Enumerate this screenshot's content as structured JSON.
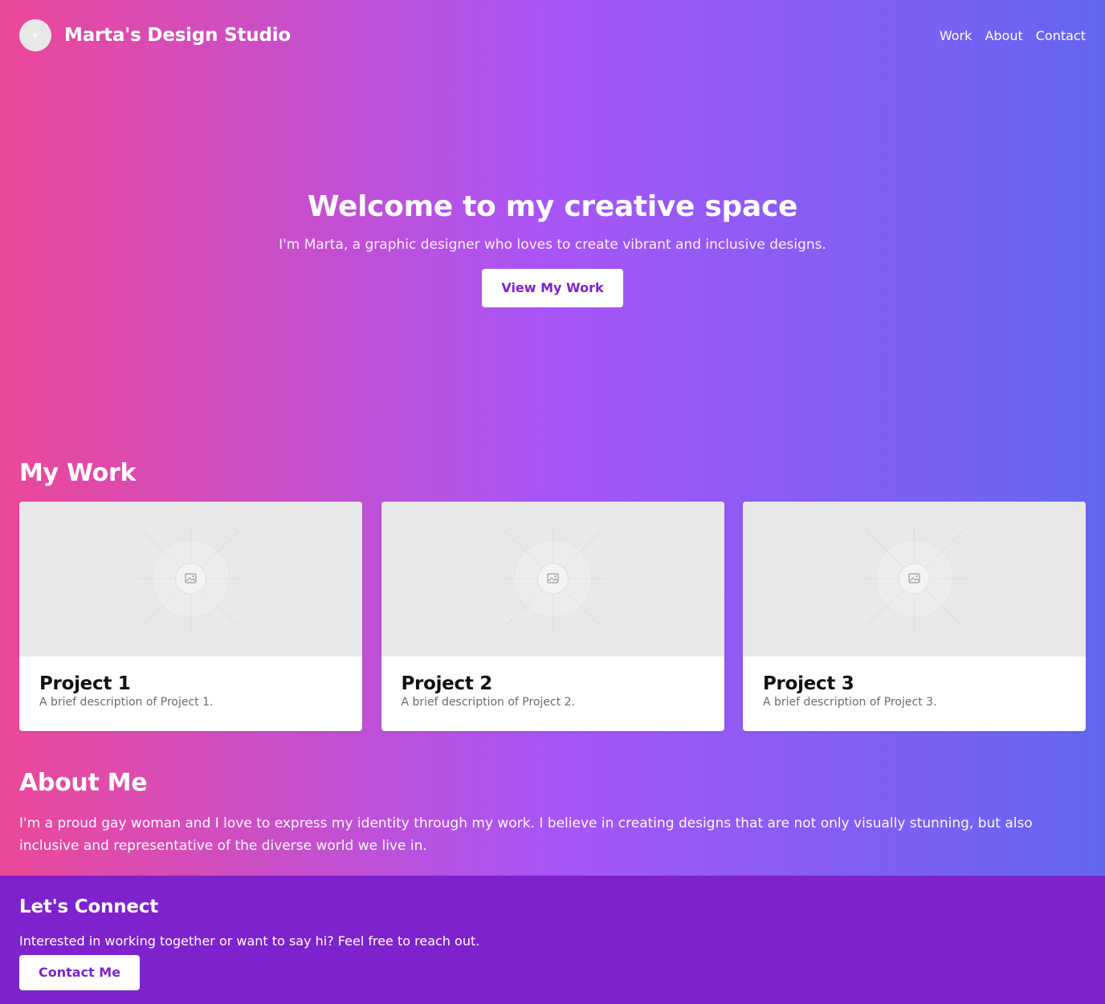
{
  "header": {
    "brand_name": "Marta's Design Studio",
    "nav": [
      "Work",
      "About",
      "Contact"
    ]
  },
  "hero": {
    "title": "Welcome to my creative space",
    "subtitle": "I'm Marta, a graphic designer who loves to create vibrant and inclusive designs.",
    "cta_label": "View My Work"
  },
  "work": {
    "title": "My Work",
    "projects": [
      {
        "title": "Project 1",
        "description": "A brief description of Project 1.",
        "image_icon": "image-placeholder-icon"
      },
      {
        "title": "Project 2",
        "description": "A brief description of Project 2.",
        "image_icon": "image-placeholder-icon"
      },
      {
        "title": "Project 3",
        "description": "A brief description of Project 3.",
        "image_icon": "image-placeholder-icon"
      }
    ]
  },
  "about": {
    "title": "About Me",
    "text": "I'm a proud gay woman and I love to express my identity through my work. I believe in creating designs that are not only visually stunning, but also inclusive and representative of the diverse world we live in."
  },
  "footer": {
    "title": "Let's Connect",
    "text": "Interested in working together or want to say hi? Feel free to reach out.",
    "cta_label": "Contact Me"
  },
  "colors": {
    "gradient": [
      "#ec4899",
      "#a855f7",
      "#6366f1"
    ],
    "footer_bg": "#7e22ce",
    "button_text": "#7e22ce"
  }
}
